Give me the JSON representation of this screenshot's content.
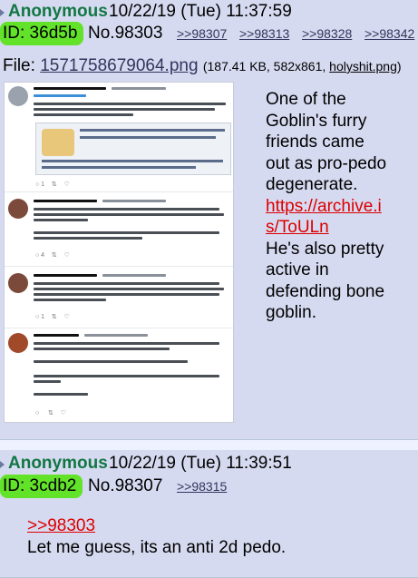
{
  "post1": {
    "name": "Anonymous",
    "date": "10/22/19 (Tue) 11:37:59",
    "id": "ID: 36d5b",
    "number": "No.98303",
    "replies": [
      ">>98307",
      ">>98313",
      ">>98328",
      ">>98342"
    ],
    "file_label": "File:",
    "file_name": "1571758679064.png",
    "file_meta_prefix": "(187.41 KB, 582x861,",
    "file_meta_name": "holyshit.png",
    "file_meta_suffix": ")",
    "body_lines": [
      "One of the",
      "Goblin's furry",
      "friends came",
      "out as pro-pedo",
      "degenerate."
    ],
    "link_lines": [
      "https://archive.i",
      "s/ToULn"
    ],
    "body_lines2": [
      "He's also pretty",
      "active in",
      "defending bone",
      "goblin."
    ]
  },
  "post2": {
    "name": "Anonymous",
    "date": "10/22/19 (Tue) 11:39:51",
    "id": "ID: 3cdb2",
    "number": "No.98307",
    "replies": [
      ">>98315"
    ],
    "quote": ">>98303",
    "text": "Let me guess, its an anti 2d pedo."
  },
  "colors": {
    "post_bg": "#d6daf0",
    "name": "#117743",
    "id_bg": "#62e329",
    "quote": "#dd0000",
    "link": "#34345c"
  }
}
